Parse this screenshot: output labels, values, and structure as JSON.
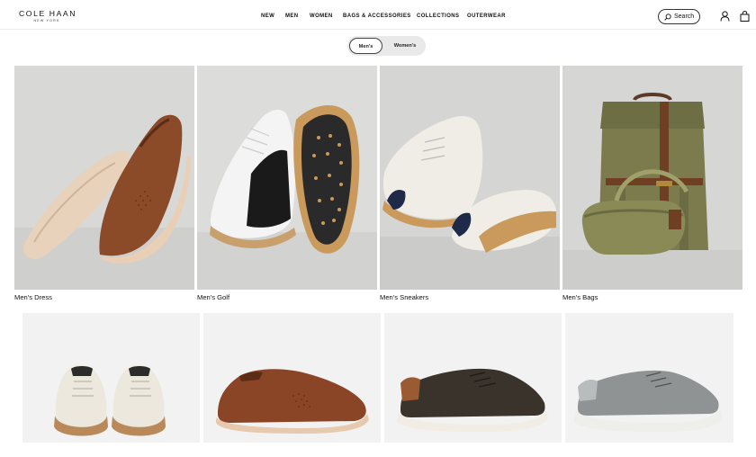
{
  "brand": {
    "name": "COLE HAAN",
    "tagline": "NEW YORK"
  },
  "nav": {
    "items": [
      {
        "label": "NEW"
      },
      {
        "label": "MEN"
      },
      {
        "label": "WOMEN"
      },
      {
        "label": "BAGS & ACCESSORIES"
      },
      {
        "label": "COLLECTIONS"
      },
      {
        "label": "OUTERWEAR"
      }
    ]
  },
  "header_actions": {
    "search_label": "Search",
    "icons": [
      "search-icon",
      "account-icon",
      "shopping-bag-icon"
    ]
  },
  "gender_toggle": {
    "options": [
      "Men's",
      "Women's"
    ],
    "selected": "Men's"
  },
  "categories": [
    {
      "label": "Men's Dress"
    },
    {
      "label": "Men's Golf"
    },
    {
      "label": "Men's Sneakers"
    },
    {
      "label": "Men's Bags"
    }
  ],
  "colors": {
    "tile_background": "#d9d9d7",
    "product_background": "#f2f2f2",
    "toggle_background": "#e9e9e9",
    "text": "#111111"
  }
}
